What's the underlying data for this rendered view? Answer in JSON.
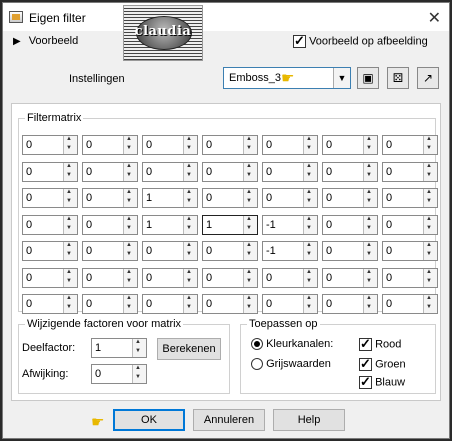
{
  "window": {
    "title": "Eigen filter",
    "logo_text": "claudia"
  },
  "top": {
    "preview_label": "Voorbeeld",
    "preview_on_image_label": "Voorbeeld op afbeelding",
    "preview_on_image_checked": true,
    "settings_label": "Instellingen",
    "preset_value": "Emboss_3"
  },
  "matrix": {
    "title": "Filtermatrix",
    "rows": [
      [
        "0",
        "0",
        "0",
        "0",
        "0",
        "0",
        "0"
      ],
      [
        "0",
        "0",
        "0",
        "0",
        "0",
        "0",
        "0"
      ],
      [
        "0",
        "0",
        "1",
        "0",
        "0",
        "0",
        "0"
      ],
      [
        "0",
        "0",
        "1",
        "1",
        "-1",
        "0",
        "0"
      ],
      [
        "0",
        "0",
        "0",
        "0",
        "-1",
        "0",
        "0"
      ],
      [
        "0",
        "0",
        "0",
        "0",
        "0",
        "0",
        "0"
      ],
      [
        "0",
        "0",
        "0",
        "0",
        "0",
        "0",
        "0"
      ]
    ]
  },
  "factors": {
    "title": "Wijzigende factoren voor matrix",
    "divisor_label": "Deelfactor:",
    "divisor_value": "1",
    "calculate_label": "Berekenen",
    "bias_label": "Afwijking:",
    "bias_value": "0"
  },
  "apply": {
    "title": "Toepassen op",
    "color_channels_label": "Kleurkanalen:",
    "grayscale_label": "Grijswaarden",
    "mode": "color_channels",
    "red_label": "Rood",
    "green_label": "Groen",
    "blue_label": "Blauw",
    "red_checked": true,
    "green_checked": true,
    "blue_checked": true
  },
  "buttons": {
    "ok": "OK",
    "cancel": "Annuleren",
    "help": "Help"
  },
  "icons": {
    "preview_arrow": "triangle-right-icon",
    "save": "save-icon",
    "randomize": "dice-icon",
    "load": "load-preset-icon",
    "pointer": "pointing-hand-icon"
  }
}
